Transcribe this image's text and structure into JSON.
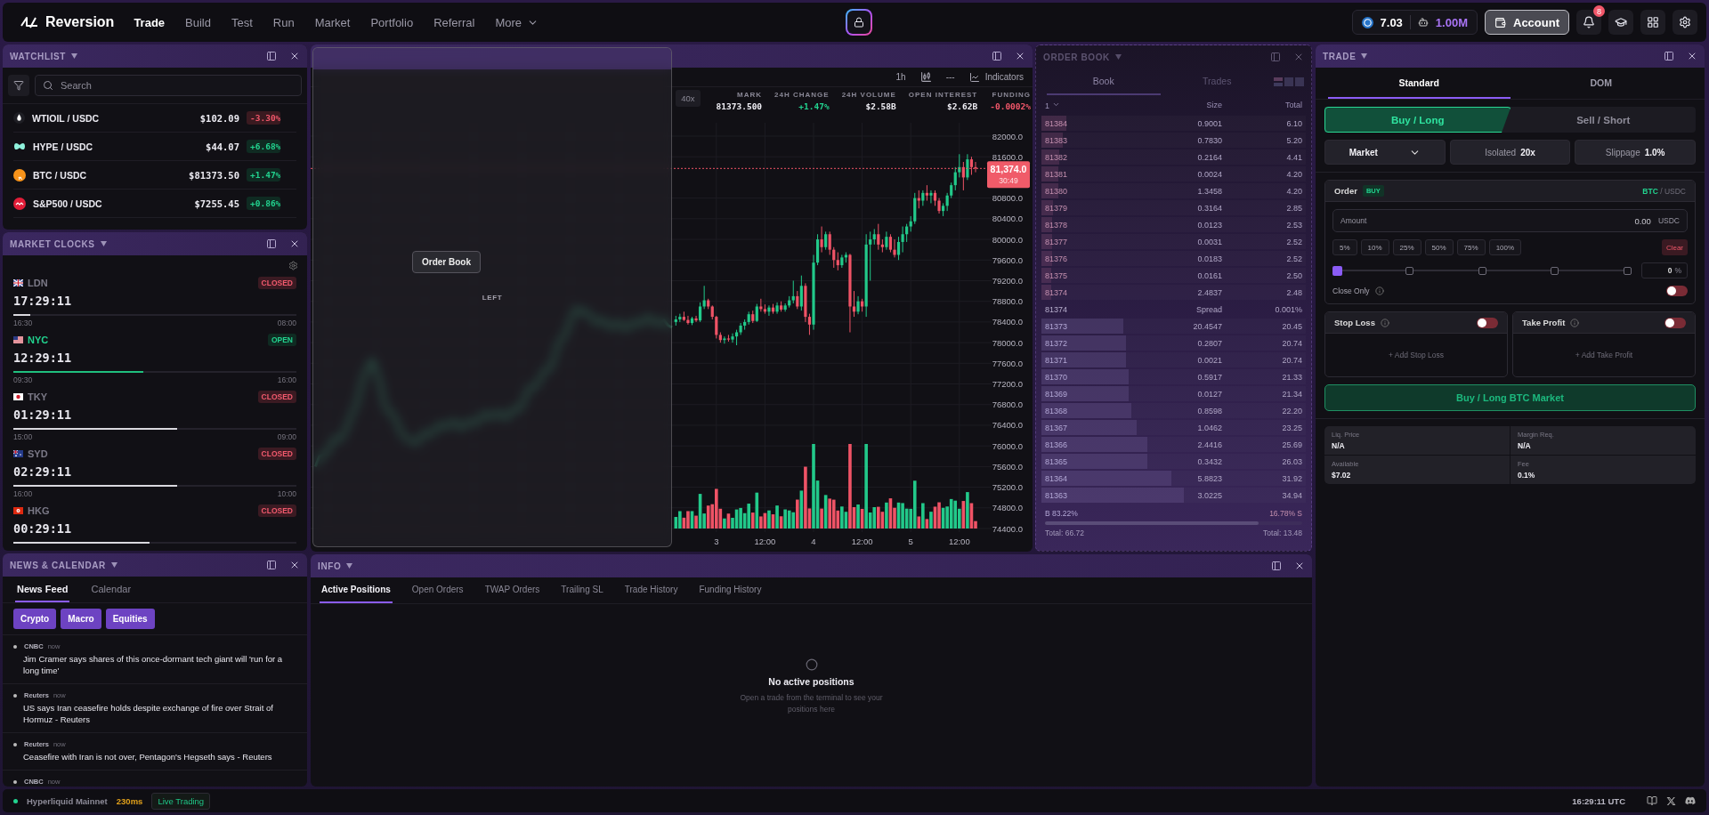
{
  "top_bar": {
    "brand": "Reversion",
    "nav": [
      {
        "label": "Trade",
        "selected": true
      },
      {
        "label": "Build",
        "selected": false
      },
      {
        "label": "Test",
        "selected": false
      },
      {
        "label": "Run",
        "selected": false
      },
      {
        "label": "Market",
        "selected": false
      },
      {
        "label": "Portfolio",
        "selected": false
      },
      {
        "label": "Referral",
        "selected": false
      },
      {
        "label": "More",
        "selected": false
      }
    ],
    "balance": "7.03",
    "points": "1.00M",
    "account": "Account",
    "notifications": "8"
  },
  "watchlist": {
    "title": "WATCHLIST",
    "search": {
      "placeholder": "Search"
    },
    "items": [
      {
        "kind": "oil",
        "symbol": "WTIOIL / USDC",
        "price": "$102.09",
        "change": "-3.30%",
        "positive": false
      },
      {
        "kind": "hype",
        "symbol": "HYPE / USDC",
        "price": "$44.07",
        "change": "+6.68%",
        "positive": true
      },
      {
        "kind": "btc",
        "symbol": "BTC / USDC",
        "price": "$81373.50",
        "change": "+1.47%",
        "positive": true
      },
      {
        "kind": "spx",
        "symbol": "S&P500 / USDC",
        "price": "$7255.45",
        "change": "+0.86%",
        "positive": true
      }
    ]
  },
  "market_clocks": {
    "title": "MARKET CLOCKS",
    "clocks": [
      {
        "kind": "gb",
        "city": "LDN",
        "status": "CLOSED",
        "open": false,
        "time": "17:29:11",
        "level": 0.06,
        "start": "16:30",
        "end": "08:00"
      },
      {
        "kind": "us",
        "city": "NYC",
        "status": "OPEN",
        "open": true,
        "time": "12:29:11",
        "level": 0.46,
        "start": "09:30",
        "end": "16:00"
      },
      {
        "kind": "jp",
        "city": "TKY",
        "status": "CLOSED",
        "open": false,
        "time": "01:29:11",
        "level": 0.58,
        "start": "15:00",
        "end": "09:00"
      },
      {
        "kind": "au",
        "city": "SYD",
        "status": "CLOSED",
        "open": false,
        "time": "02:29:11",
        "level": 0.58,
        "start": "16:00",
        "end": "10:00"
      },
      {
        "kind": "hk",
        "city": "HKG",
        "status": "CLOSED",
        "open": false,
        "time": "00:29:11",
        "level": 0.48
      }
    ]
  },
  "chart": {
    "timeframe": "1h",
    "line_style": "---",
    "indicators": "Indicators",
    "leverage": "40x",
    "stats": [
      {
        "label": "MARK",
        "value": "81373.500",
        "color": "#f0eff5"
      },
      {
        "label": "24H CHANGE",
        "value": "+1.47%",
        "color": "#22d38f"
      },
      {
        "label": "24H VOLUME",
        "value": "$2.58B",
        "color": "#f0eff5"
      },
      {
        "label": "OPEN INTEREST",
        "value": "$2.62B",
        "color": "#f0eff5"
      },
      {
        "label": "FUNDING",
        "value": "-0.0002%",
        "color": "#f2576a"
      }
    ],
    "chart_data": {
      "type": "candlestick",
      "categories": [
        null,
        null,
        null,
        null,
        null,
        null,
        null,
        null,
        null,
        null,
        "3",
        null,
        null,
        null,
        null,
        null,
        null,
        null,
        null,
        null,
        null,
        null,
        "12:00",
        null,
        null,
        null,
        null,
        null,
        null,
        null,
        null,
        null,
        null,
        null,
        "4",
        null,
        null,
        null,
        null,
        null,
        null,
        null,
        null,
        null,
        null,
        null,
        "12:00",
        null,
        null,
        null,
        null,
        null,
        null,
        null,
        null,
        null,
        null,
        null,
        "5",
        null,
        null,
        null,
        null,
        null,
        null,
        null,
        null,
        null,
        null,
        null,
        "12:00",
        null,
        null,
        null,
        null
      ],
      "ohlc": [
        [
          78400,
          78520,
          78330,
          78450
        ],
        [
          78450,
          78560,
          78400,
          78500
        ],
        [
          78500,
          78600,
          78420,
          78440
        ],
        [
          78440,
          78520,
          78350,
          78380
        ],
        [
          78380,
          78500,
          78340,
          78470
        ],
        [
          78470,
          78520,
          78400,
          78430
        ],
        [
          78430,
          78780,
          78400,
          78700
        ],
        [
          78700,
          79100,
          78650,
          78820
        ],
        [
          78820,
          78850,
          78650,
          78700
        ],
        [
          78700,
          78720,
          78450,
          78500
        ],
        [
          78500,
          78520,
          78080,
          78150
        ],
        [
          78150,
          78200,
          78000,
          78050
        ],
        [
          78050,
          78120,
          77980,
          78080
        ],
        [
          78080,
          78150,
          78020,
          78060
        ],
        [
          78060,
          78180,
          78000,
          78120
        ],
        [
          78120,
          78250,
          77950,
          78200
        ],
        [
          78200,
          78380,
          78150,
          78330
        ],
        [
          78330,
          78450,
          78250,
          78400
        ],
        [
          78400,
          78600,
          78350,
          78550
        ],
        [
          78550,
          78620,
          78380,
          78420
        ],
        [
          78420,
          78750,
          78400,
          78700
        ],
        [
          78700,
          78850,
          78600,
          78650
        ],
        [
          78650,
          78740,
          78560,
          78600
        ],
        [
          78600,
          78720,
          78520,
          78680
        ],
        [
          78680,
          78750,
          78560,
          78600
        ],
        [
          78600,
          78780,
          78560,
          78720
        ],
        [
          78720,
          78800,
          78600,
          78640
        ],
        [
          78640,
          78760,
          78600,
          78720
        ],
        [
          78720,
          78900,
          78680,
          78820
        ],
        [
          78820,
          79200,
          78760,
          78900
        ],
        [
          78900,
          79000,
          78650,
          78700
        ],
        [
          78700,
          79300,
          78620,
          79100
        ],
        [
          79100,
          79150,
          78400,
          78500
        ],
        [
          78500,
          78560,
          78150,
          78350
        ],
        [
          78350,
          79700,
          78250,
          79550
        ],
        [
          79550,
          80100,
          79500,
          80000
        ],
        [
          80000,
          80250,
          79750,
          79850
        ],
        [
          79850,
          80150,
          79800,
          80100
        ],
        [
          80100,
          80150,
          79700,
          79800
        ],
        [
          79800,
          79850,
          79450,
          79600
        ],
        [
          79600,
          79750,
          79400,
          79500
        ],
        [
          79500,
          79700,
          79450,
          79650
        ],
        [
          79650,
          79750,
          79550,
          79700
        ],
        [
          79700,
          79720,
          78200,
          78700
        ],
        [
          78700,
          79000,
          78500,
          78600
        ],
        [
          78600,
          78900,
          78550,
          78800
        ],
        [
          78800,
          78850,
          78600,
          78700
        ],
        [
          78700,
          80100,
          78500,
          79900
        ],
        [
          79900,
          80150,
          79200,
          80000
        ],
        [
          80000,
          80200,
          79900,
          80100
        ],
        [
          80100,
          80300,
          79800,
          79900
        ],
        [
          79900,
          80000,
          79750,
          79850
        ],
        [
          79850,
          80150,
          79800,
          80050
        ],
        [
          80050,
          80100,
          79750,
          79800
        ],
        [
          79800,
          80000,
          79650,
          79700
        ],
        [
          79700,
          80050,
          79600,
          79950
        ],
        [
          79950,
          80250,
          79750,
          80100
        ],
        [
          80100,
          80300,
          79950,
          80250
        ],
        [
          80250,
          80450,
          80150,
          80350
        ],
        [
          80350,
          80900,
          80300,
          80800
        ],
        [
          80800,
          80950,
          80600,
          80750
        ],
        [
          80750,
          80950,
          80650,
          80900
        ],
        [
          80900,
          81050,
          80750,
          80850
        ],
        [
          80850,
          80950,
          80700,
          80900
        ],
        [
          80900,
          80950,
          80650,
          80750
        ],
        [
          80750,
          80800,
          80500,
          80550
        ],
        [
          80550,
          80700,
          80450,
          80650
        ],
        [
          80650,
          80900,
          80550,
          80850
        ],
        [
          80850,
          81100,
          80800,
          81050
        ],
        [
          81050,
          81400,
          80950,
          81300
        ],
        [
          81300,
          81650,
          81200,
          81400
        ],
        [
          81400,
          81500,
          80950,
          81200
        ],
        [
          81200,
          81650,
          81150,
          81550
        ],
        [
          81550,
          81600,
          81250,
          81400
        ],
        [
          81400,
          81500,
          81300,
          81374
        ]
      ],
      "ylim": [
        74400,
        82000
      ],
      "yticks": [
        {
          "value": 82000,
          "label": "82000.0"
        },
        {
          "value": 81600,
          "label": "81600.0"
        },
        {
          "value": 80800,
          "label": "80800.0"
        },
        {
          "value": 80400,
          "label": "80400.0"
        },
        {
          "value": 80000,
          "label": "80000.0"
        },
        {
          "value": 79600,
          "label": "79600.0"
        },
        {
          "value": 79200,
          "label": "79200.0"
        },
        {
          "value": 78800,
          "label": "78800.0"
        },
        {
          "value": 78400,
          "label": "78400.0"
        },
        {
          "value": 78000,
          "label": "78000.0"
        },
        {
          "value": 77600,
          "label": "77600.0"
        },
        {
          "value": 77200,
          "label": "77200.0"
        },
        {
          "value": 76800,
          "label": "76800.0"
        },
        {
          "value": 76400,
          "label": "76400.0"
        },
        {
          "value": 76000,
          "label": "76000.0"
        },
        {
          "value": 75600,
          "label": "75600.0"
        },
        {
          "value": 75200,
          "label": "75200.0"
        },
        {
          "value": 74800,
          "label": "74800.0"
        },
        {
          "value": 74400,
          "label": "74400.0"
        }
      ],
      "grid": true,
      "ref_lines": [
        {
          "axis": "y",
          "value": 81374,
          "color": "#ef5366"
        }
      ]
    },
    "last_price": "81,374.0",
    "countdown": "30:49"
  },
  "drag_preview": {
    "label": "Order Book",
    "zone": "LEFT"
  },
  "order_book": {
    "title": "ORDER BOOK",
    "tabs": [
      {
        "label": "Book",
        "selected": true
      },
      {
        "label": "Trades",
        "selected": false
      }
    ],
    "columns": [
      "1",
      "Size",
      "Total"
    ],
    "asks": [
      {
        "price": "81384",
        "size": "0.9001",
        "total": "6.10",
        "level": 0.094
      },
      {
        "price": "81383",
        "size": "0.7830",
        "total": "5.20",
        "level": 0.08
      },
      {
        "price": "81382",
        "size": "0.2164",
        "total": "4.41",
        "level": 0.068
      },
      {
        "price": "81381",
        "size": "0.0024",
        "total": "4.20",
        "level": 0.065
      },
      {
        "price": "81380",
        "size": "1.3458",
        "total": "4.20",
        "level": 0.065
      },
      {
        "price": "81379",
        "size": "0.3164",
        "total": "2.85",
        "level": 0.044
      },
      {
        "price": "81378",
        "size": "0.0123",
        "total": "2.53",
        "level": 0.039
      },
      {
        "price": "81377",
        "size": "0.0031",
        "total": "2.52",
        "level": 0.039
      },
      {
        "price": "81376",
        "size": "0.0183",
        "total": "2.52",
        "level": 0.039
      },
      {
        "price": "81375",
        "size": "0.0161",
        "total": "2.50",
        "level": 0.038
      },
      {
        "price": "81374",
        "size": "2.4837",
        "total": "2.48",
        "level": 0.038
      }
    ],
    "spread": {
      "price": "81374",
      "label": "Spread",
      "value": "0.001%"
    },
    "bids": [
      {
        "price": "81373",
        "size": "20.4547",
        "total": "20.45",
        "level": 0.31
      },
      {
        "price": "81372",
        "size": "0.2807",
        "total": "20.74",
        "level": 0.32
      },
      {
        "price": "81371",
        "size": "0.0021",
        "total": "20.74",
        "level": 0.32
      },
      {
        "price": "81370",
        "size": "0.5917",
        "total": "21.33",
        "level": 0.33
      },
      {
        "price": "81369",
        "size": "0.0127",
        "total": "21.34",
        "level": 0.33
      },
      {
        "price": "81368",
        "size": "0.8598",
        "total": "22.20",
        "level": 0.34
      },
      {
        "price": "81367",
        "size": "1.0462",
        "total": "23.25",
        "level": 0.36
      },
      {
        "price": "81366",
        "size": "2.4416",
        "total": "25.69",
        "level": 0.4
      },
      {
        "price": "81365",
        "size": "0.3432",
        "total": "26.03",
        "level": 0.4
      },
      {
        "price": "81364",
        "size": "5.8823",
        "total": "31.92",
        "level": 0.49
      },
      {
        "price": "81363",
        "size": "3.0225",
        "total": "34.94",
        "level": 0.54
      }
    ],
    "buy_share": "B 83.22%",
    "sell_share": "16.78% S",
    "balance": {
      "level": 0.83
    },
    "buy_total": "Total: 66.72",
    "sell_total": "Total: 13.48"
  },
  "trade": {
    "title": "TRADE",
    "tabs": [
      {
        "label": "Standard",
        "selected": true
      },
      {
        "label": "DOM",
        "selected": false
      }
    ],
    "sides": [
      {
        "kind": "buy",
        "label": "Buy / Long",
        "selected": true
      },
      {
        "kind": "sell",
        "label": "Sell / Short",
        "selected": false
      }
    ],
    "order_type": "Market",
    "margin": {
      "label": "Isolated",
      "value": "20x"
    },
    "slippage": {
      "label": "Slippage",
      "value": "1.0%"
    },
    "order": {
      "title": "Order",
      "badge": "BUY",
      "base": "BTC",
      "quote": "/ USDC"
    },
    "amount": {
      "label": "Amount",
      "value": "0.00",
      "unit": "USDC"
    },
    "percents": [
      "5%",
      "10%",
      "25%",
      "50%",
      "75%",
      "100%"
    ],
    "clear": "Clear",
    "size_slider": {
      "level": 0,
      "value": "0",
      "unit": "%"
    },
    "close_only": {
      "label": "Close Only",
      "on": false
    },
    "stop_loss": {
      "label": "Stop Loss",
      "on": false,
      "add": "+ Add Stop Loss"
    },
    "take_profit": {
      "label": "Take Profit",
      "on": false,
      "add": "+ Add Take Profit"
    },
    "submit": "Buy / Long BTC Market",
    "stats": [
      {
        "label": "Liq. Price",
        "value": "N/A"
      },
      {
        "label": "Margin Req.",
        "value": "N/A"
      },
      {
        "label": "Available",
        "value": "$7.02"
      },
      {
        "label": "Fee",
        "value": "0.1%"
      }
    ]
  },
  "news": {
    "title": "NEWS & CALENDAR",
    "tabs": [
      {
        "label": "News Feed",
        "selected": true
      },
      {
        "label": "Calendar",
        "selected": false
      }
    ],
    "filters": [
      {
        "label": "Crypto",
        "selected": true
      },
      {
        "label": "Macro",
        "selected": true
      },
      {
        "label": "Equities",
        "selected": true
      }
    ],
    "items": [
      {
        "source": "CNBC",
        "time": "now",
        "headline": "Jim Cramer says shares of this once-dormant tech giant will 'run for a long time'"
      },
      {
        "source": "Reuters",
        "time": "now",
        "headline": "US says Iran ceasefire holds despite exchange of fire over Strait of Hormuz - Reuters"
      },
      {
        "source": "Reuters",
        "time": "now",
        "headline": "Ceasefire with Iran is not over, Pentagon's Hegseth says - Reuters"
      },
      {
        "source": "CNBC",
        "time": "now"
      }
    ]
  },
  "info": {
    "title": "INFO",
    "tabs": [
      {
        "label": "Active Positions",
        "selected": true
      },
      {
        "label": "Open Orders",
        "selected": false
      },
      {
        "label": "TWAP Orders",
        "selected": false
      },
      {
        "label": "Trailing SL",
        "selected": false
      },
      {
        "label": "Trade History",
        "selected": false
      },
      {
        "label": "Funding History",
        "selected": false
      }
    ],
    "empty_title": "No active positions",
    "empty_text": "Open a trade from the terminal to see your positions here"
  },
  "status_bar": {
    "network": "Hyperliquid Mainnet",
    "connected": true,
    "latency": "230ms",
    "mode": "Live Trading",
    "time": "16:29:11 UTC"
  }
}
